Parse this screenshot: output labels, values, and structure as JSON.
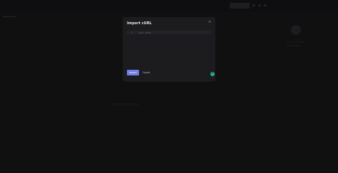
{
  "modal": {
    "title": "Import cURL",
    "close_icon": "close-icon",
    "editor": {
      "line_number": "1",
      "code": "curl <url>"
    },
    "import_label": "Import",
    "cancel_label": "Cancel"
  },
  "colors": {
    "accent": "#6d7fe0",
    "fab": "#1fb58a",
    "modal_bg": "#1c1c1f",
    "page_bg": "#202023"
  }
}
